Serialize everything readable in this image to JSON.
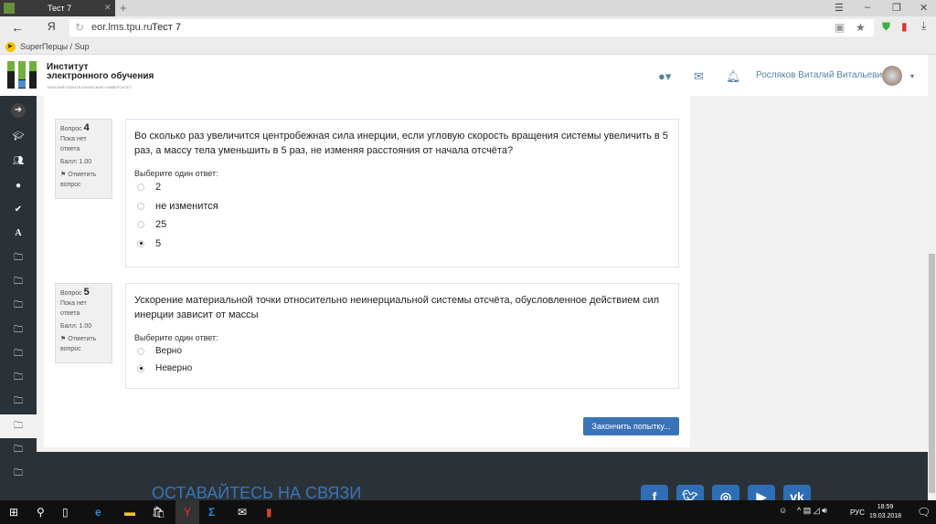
{
  "browser": {
    "tab_title": "Тест 7",
    "url_domain": "eor.lms.tpu.ru",
    "url_title": "Тест 7",
    "bookmark": "SuperПерцы / Sup"
  },
  "header": {
    "name_line1": "Институт",
    "name_line2": "электронного обучения",
    "subtitle": "ТОМСКИЙ ПОЛИТЕХНИЧЕСКИЙ УНИВЕРСИТЕТ",
    "user_name": "Росляков Виталий Витальевич"
  },
  "questions": [
    {
      "label": "Вопрос",
      "number": "4",
      "status": "Пока нет ответа",
      "score": "Балл: 1.00",
      "flag": "Отметить вопрос",
      "text": "Во сколько раз увеличится центробежная сила инерции, если угловую скорость вращения системы увеличить в 5 раз, а массу тела уменьшить в 5 раз, не изменяя расстояния от начала отсчёта?",
      "prompt": "Выберите один ответ:",
      "options": [
        "2",
        "не изменится",
        "25",
        "5"
      ],
      "selected": 3
    },
    {
      "label": "Вопрос",
      "number": "5",
      "status": "Пока нет ответа",
      "score": "Балл: 1.00",
      "flag": "Отметить вопрос",
      "text": "Ускорение материальной точки относительно неинерциальной системы отсчёта, обусловленное действием сил инерции зависит от массы",
      "prompt": "Выберите один ответ:",
      "options": [
        "Верно",
        "Неверно"
      ],
      "selected": 1
    }
  ],
  "finish_button": "Закончить попытку...",
  "footer": {
    "stay_connected": "ОСТАВАЙТЕСЬ НА СВЯЗИ"
  },
  "taskbar": {
    "lang": "РУС",
    "time": "18:59",
    "date": "19.03.2018"
  }
}
